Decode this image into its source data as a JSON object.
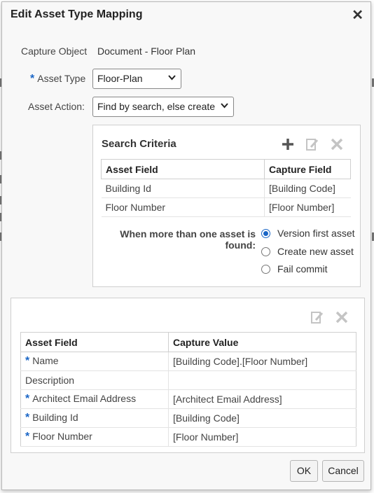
{
  "dialog": {
    "title": "Edit Asset Type Mapping",
    "close_icon": "close-icon"
  },
  "form": {
    "capture_object_label": "Capture Object",
    "capture_object_value": "Document - Floor Plan",
    "asset_type_label": "Asset Type",
    "asset_type_value": "Floor-Plan",
    "asset_action_label": "Asset Action:",
    "asset_action_value": "Find by search, else create"
  },
  "search_criteria": {
    "title": "Search Criteria",
    "icons": [
      "add-icon",
      "edit-icon",
      "delete-icon"
    ],
    "columns": [
      "Asset Field",
      "Capture Field"
    ],
    "rows": [
      [
        "Building Id",
        "[Building Code]"
      ],
      [
        "Floor Number",
        "[Floor Number]"
      ]
    ],
    "multi_label_line1": "When more than one asset is",
    "multi_label_line2": "found:",
    "options": [
      "Version first asset",
      "Create new asset",
      "Fail commit"
    ],
    "selected_option": "Version first asset"
  },
  "field_mapping": {
    "icons": [
      "edit-icon",
      "delete-icon"
    ],
    "columns": [
      "Asset Field",
      "Capture Value"
    ],
    "rows": [
      {
        "required": true,
        "field": "Name",
        "value": "[Building Code].[Floor Number]"
      },
      {
        "required": false,
        "field": "Description",
        "value": ""
      },
      {
        "required": true,
        "field": "Architect Email Address",
        "value": "[Architect Email Address]"
      },
      {
        "required": true,
        "field": "Building Id",
        "value": "[Building Code]"
      },
      {
        "required": true,
        "field": "Floor Number",
        "value": "[Floor Number]"
      }
    ]
  },
  "buttons": {
    "ok": "OK",
    "cancel": "Cancel"
  },
  "colors": {
    "accent": "#1a66c6",
    "icon_active": "#555555",
    "icon_disabled": "#c4c4c4"
  }
}
